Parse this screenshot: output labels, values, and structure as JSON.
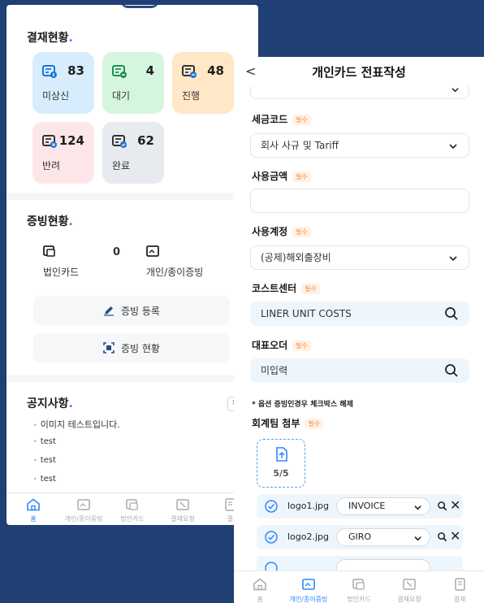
{
  "left_screen": {
    "payment_status": {
      "title": "결재현황",
      "tiles": [
        {
          "count": "83",
          "label": "미상신",
          "icon": "doc-info-icon"
        },
        {
          "count": "4",
          "label": "대기",
          "icon": "doc-wait-icon"
        },
        {
          "count": "48",
          "label": "진행",
          "icon": "doc-progress-icon"
        },
        {
          "count": "124",
          "label": "반려",
          "icon": "doc-reject-icon"
        },
        {
          "count": "62",
          "label": "완료",
          "icon": "doc-done-icon"
        }
      ]
    },
    "evidence_status": {
      "title": "증빙현황",
      "corporate_card_label": "법인카드",
      "corporate_card_count": "0",
      "personal_label": "개인/종이증빙",
      "register_button": "증빙 등록",
      "status_button": "증빙 현황"
    },
    "notice": {
      "title": "공지사항",
      "more": "더보기",
      "items": [
        "이미지 테스트입니다.",
        "test",
        "test",
        "test"
      ]
    },
    "tabs": [
      "홈",
      "개인/종이증빙",
      "법인카드",
      "결재요청",
      "결"
    ]
  },
  "right_screen": {
    "header": {
      "back": "<",
      "title": "개인카드 전표작성"
    },
    "required_badge": "필수",
    "fields": {
      "tax_code": {
        "label": "세금코드",
        "value": "회사 사규 및 Tariff"
      },
      "amount": {
        "label": "사용금액",
        "value": ""
      },
      "account": {
        "label": "사용계정",
        "value": "(공제)해외출장비"
      },
      "cost_center": {
        "label": "코스트센터",
        "value": "LINER UNIT COSTS"
      },
      "rep_order": {
        "label": "대표오더",
        "value": "미입력"
      }
    },
    "note": "* 옵션 증빙인경우 체크박스 해제",
    "attachment": {
      "label": "회계팀 첨부",
      "count": "5/5",
      "files": [
        {
          "name": "logo1.jpg",
          "type": "INVOICE"
        },
        {
          "name": "logo2.jpg",
          "type": "GIRO"
        }
      ]
    },
    "tabs": [
      "홈",
      "개인/종이증빙",
      "법인카드",
      "결재요청",
      "결재"
    ]
  },
  "colors": {
    "accent": "#2e86ff",
    "background": "#1f3f75",
    "required": "#ff8a3d"
  }
}
